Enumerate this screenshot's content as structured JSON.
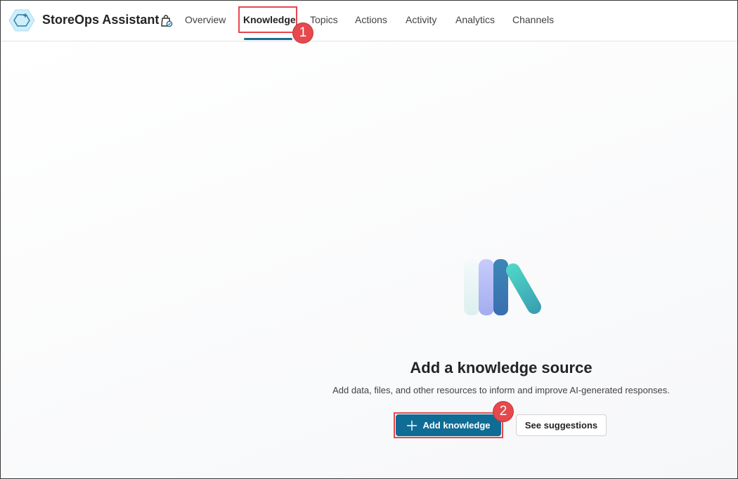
{
  "app": {
    "title": "StoreOps Assistant",
    "icon": "hexagon-sparkle-icon",
    "badge_icon": "shopping-bag-icon"
  },
  "nav": {
    "tabs": [
      {
        "label": "Overview",
        "active": false
      },
      {
        "label": "Knowledge",
        "active": true
      },
      {
        "label": "Topics",
        "active": false
      },
      {
        "label": "Actions",
        "active": false
      },
      {
        "label": "Activity",
        "active": false
      },
      {
        "label": "Analytics",
        "active": false
      },
      {
        "label": "Channels",
        "active": false
      }
    ]
  },
  "annotations": {
    "step1": "1",
    "step2": "2",
    "color": "#e5484d"
  },
  "empty_state": {
    "illustration": "books-icon",
    "title": "Add a knowledge source",
    "description": "Add data, files, and other resources to inform and improve AI-generated responses.",
    "primary_button": {
      "label": "Add knowledge",
      "icon": "plus-icon"
    },
    "secondary_button": {
      "label": "See suggestions"
    }
  },
  "colors": {
    "accent": "#0f6c95",
    "tab_indicator": "#1b6e93"
  }
}
